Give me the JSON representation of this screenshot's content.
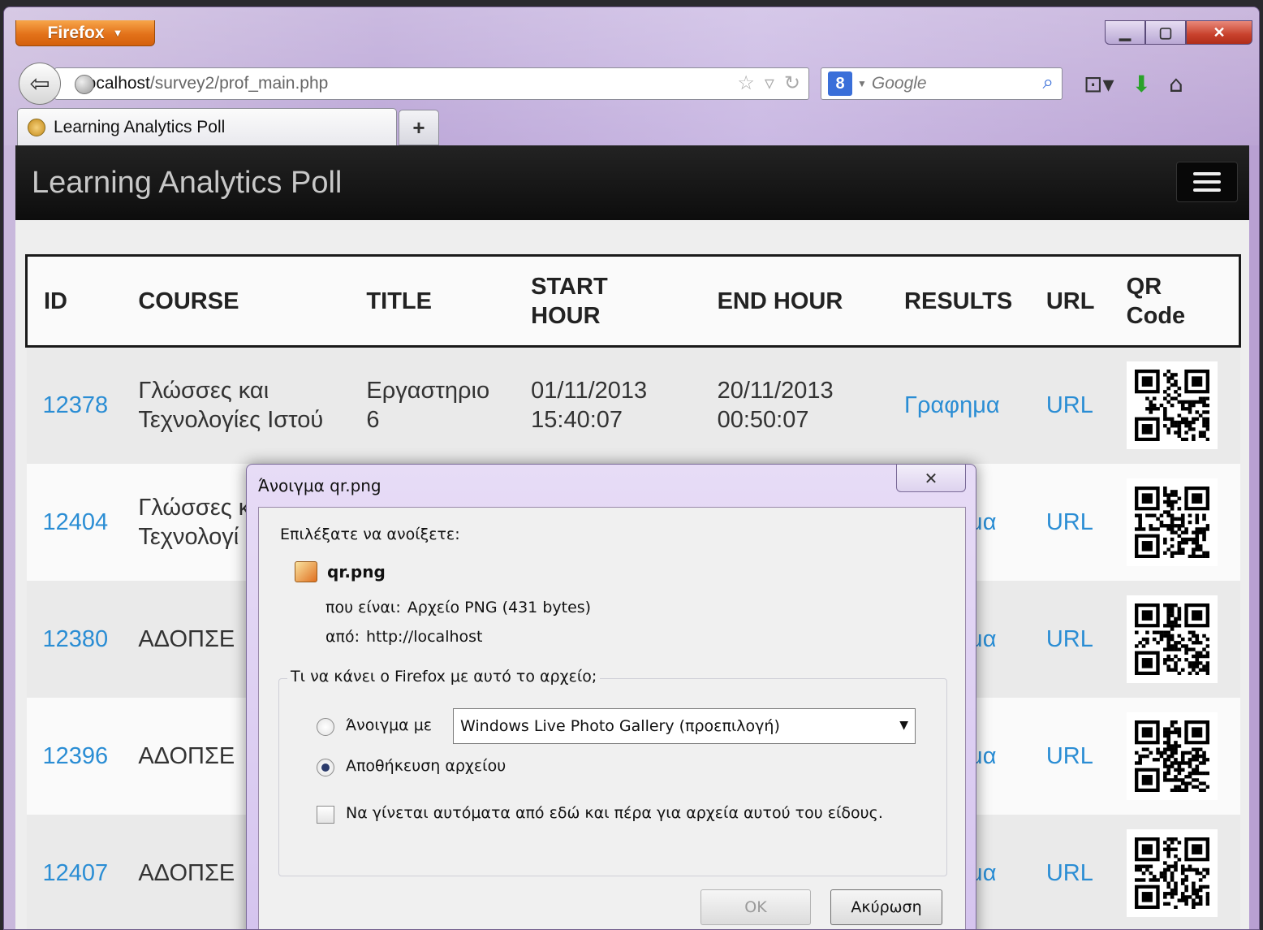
{
  "browser": {
    "app_button": "Firefox",
    "address": {
      "host": "localhost",
      "path": "/survey2/prof_main.php"
    },
    "search": {
      "engine_badge": "8",
      "placeholder": "Google"
    },
    "tabs": [
      {
        "label": "Learning Analytics Poll"
      }
    ],
    "new_tab_label": "+"
  },
  "app": {
    "title": "Learning Analytics Poll"
  },
  "table": {
    "columns": [
      {
        "line1": "ID",
        "line2": ""
      },
      {
        "line1": "COURSE",
        "line2": ""
      },
      {
        "line1": "TITLE",
        "line2": ""
      },
      {
        "line1": "START",
        "line2": "HOUR"
      },
      {
        "line1": "END HOUR",
        "line2": ""
      },
      {
        "line1": "RESULTS",
        "line2": ""
      },
      {
        "line1": "URL",
        "line2": ""
      },
      {
        "line1": "QR",
        "line2": "Code"
      }
    ],
    "rows": [
      {
        "id": "12378",
        "course": [
          "Γλώσσες και",
          "Τεχνολογίες Ιστού"
        ],
        "title": [
          "Εργαστηριο",
          "6"
        ],
        "start": [
          "01/11/2013",
          "15:40:07"
        ],
        "end": [
          "20/11/2013",
          "00:50:07"
        ],
        "results": "Γραφημα",
        "url": "URL"
      },
      {
        "id": "12404",
        "course": [
          "Γλώσσες κ",
          "Τεχνολογί"
        ],
        "title": [
          "",
          ""
        ],
        "start": [
          "",
          ""
        ],
        "end": [
          "",
          ""
        ],
        "results": "μα",
        "url": "URL"
      },
      {
        "id": "12380",
        "course": [
          "ΑΔΟΠΣΕ",
          ""
        ],
        "title": [
          "",
          ""
        ],
        "start": [
          "",
          ""
        ],
        "end": [
          "",
          ""
        ],
        "results": "μα",
        "url": "URL"
      },
      {
        "id": "12396",
        "course": [
          "ΑΔΟΠΣΕ",
          ""
        ],
        "title": [
          "",
          ""
        ],
        "start": [
          "",
          ""
        ],
        "end": [
          "",
          ""
        ],
        "results": "μα",
        "url": "URL"
      },
      {
        "id": "12407",
        "course": [
          "ΑΔΟΠΣΕ",
          ""
        ],
        "title": [
          "",
          ""
        ],
        "start": [
          "",
          ""
        ],
        "end": [
          "",
          ""
        ],
        "results": "μα",
        "url": "URL"
      }
    ]
  },
  "dialog": {
    "title": "Άνοιγμα qr.png",
    "close_glyph": "✕",
    "chosen_label": "Επιλέξατε να ανοίξετε:",
    "filename": "qr.png",
    "type_label": "που είναι:",
    "type_value": "Αρχείο PNG (431 bytes)",
    "from_label": "από:",
    "from_value": "http://localhost",
    "group_label": "Τι να κάνει ο Firefox  με αυτό το αρχείο;",
    "open_with_label": "Άνοιγμα με",
    "open_with_app": "Windows Live Photo Gallery (προεπιλογή)",
    "save_label": "Αποθήκευση αρχείου",
    "auto_label": "Να γίνεται αυτόματα από εδώ και πέρα για αρχεία αυτού του είδους.",
    "ok_label": "OK",
    "cancel_label": "Ακύρωση",
    "selected_action": "save"
  },
  "colors": {
    "link": "#2a8dd4",
    "appbar": "#111111",
    "firefox_orange": "#e3721a"
  },
  "icons": [
    "back-arrow-icon",
    "globe-icon",
    "star-icon",
    "dropdown-icon",
    "reload-icon",
    "search-icon",
    "bookmarks-icon",
    "download-icon",
    "home-icon",
    "menu-icon",
    "png-file-icon",
    "qr-code-icon"
  ]
}
